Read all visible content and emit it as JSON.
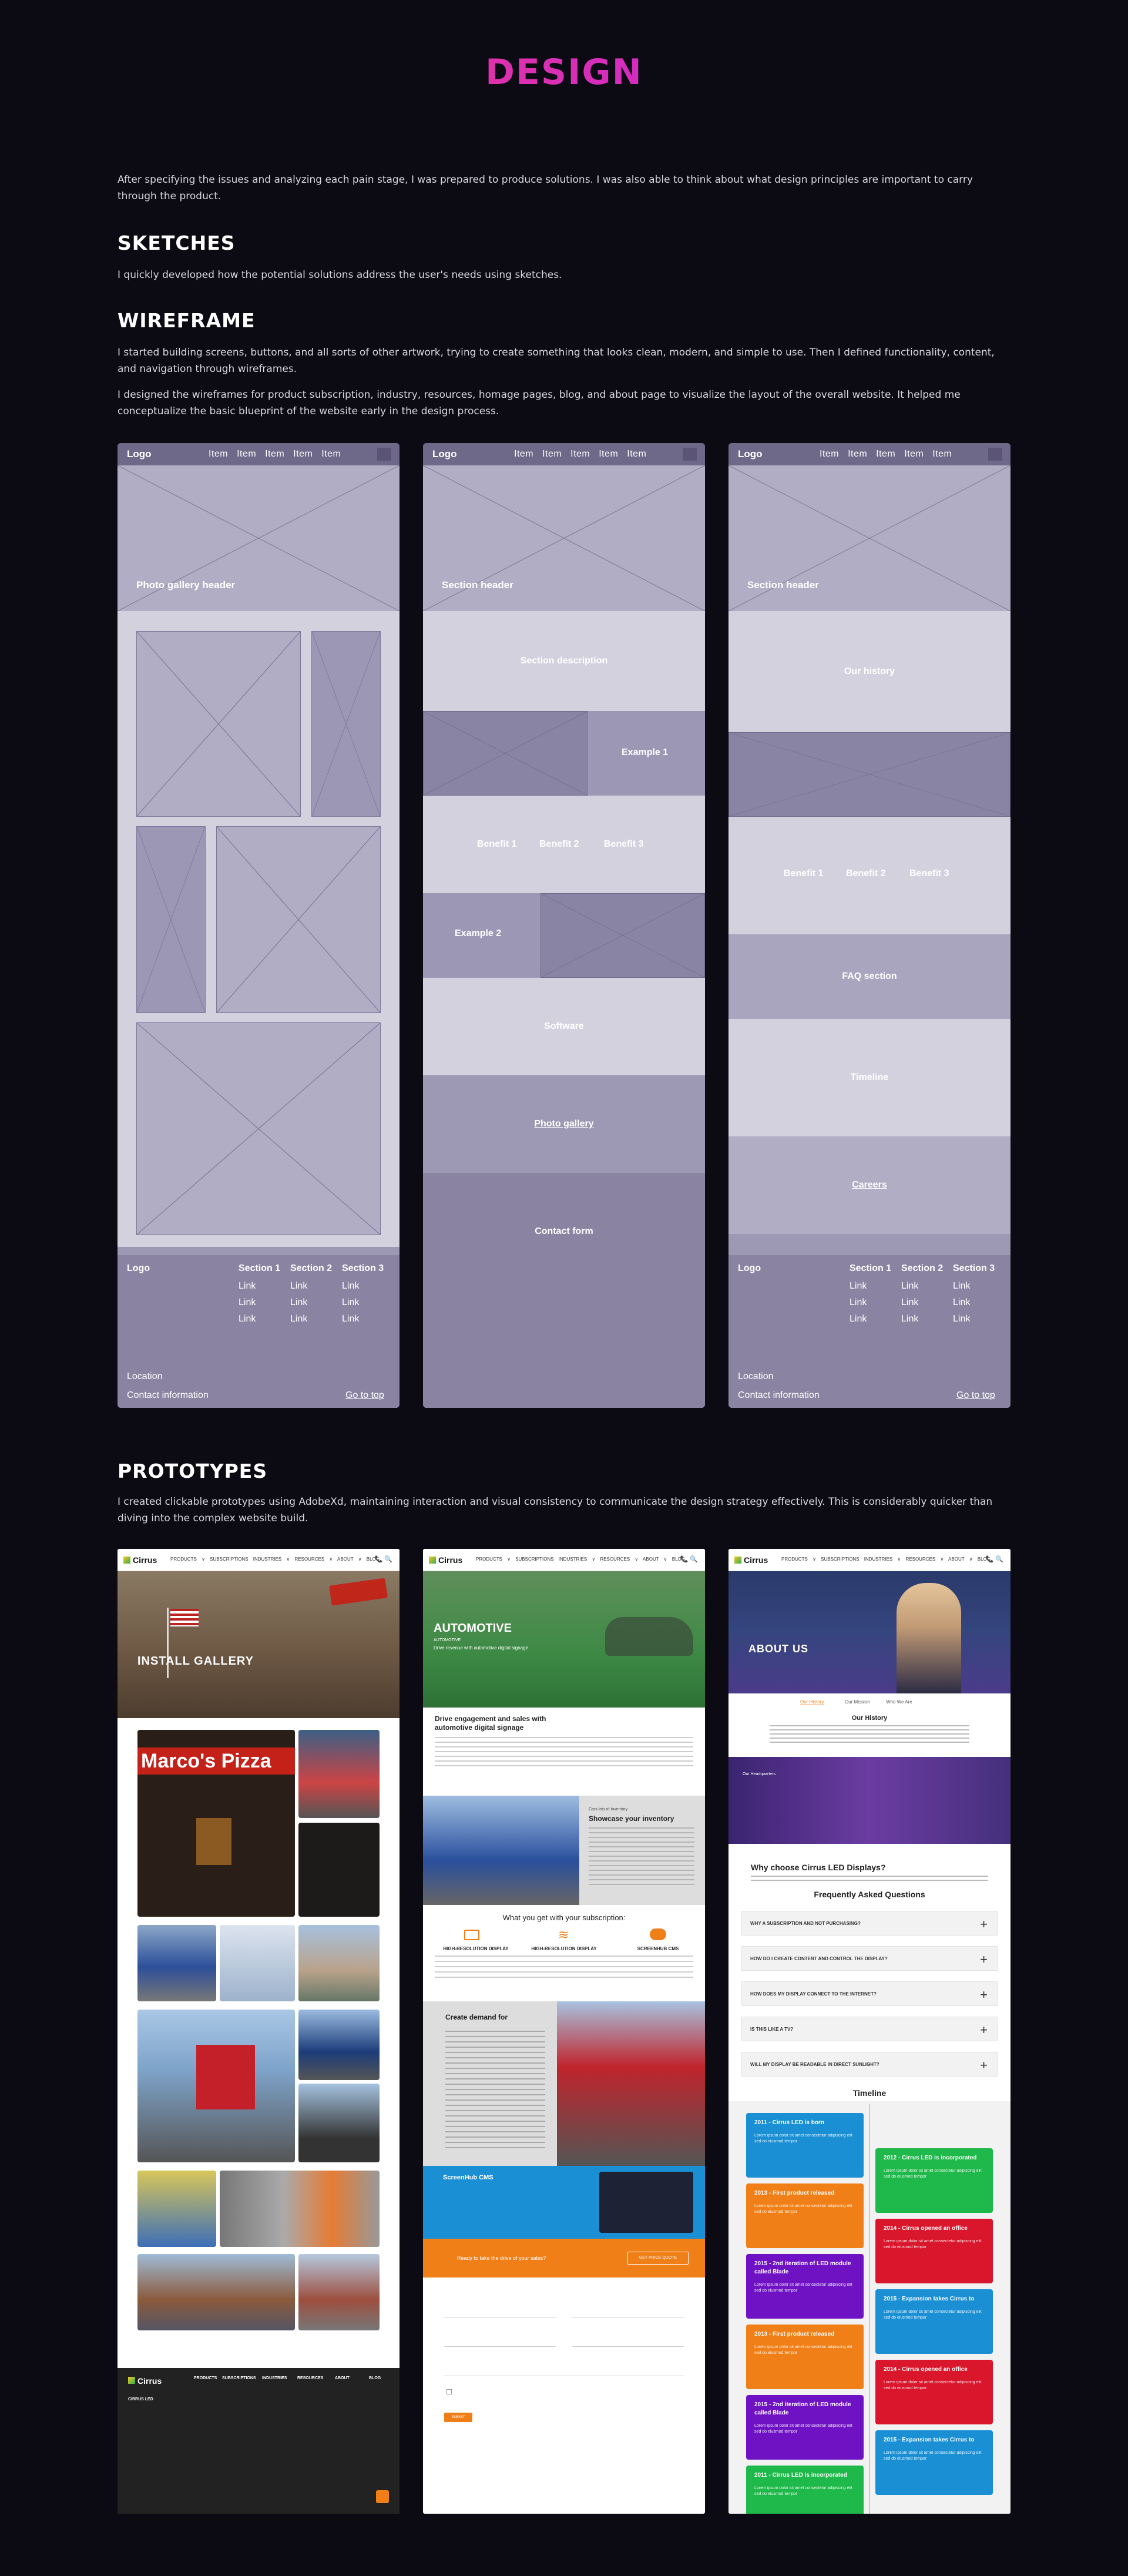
{
  "page": {
    "title": "DESIGN",
    "intro": "After specifying the issues and analyzing each pain stage, I was prepared to produce solutions. I was also able to think about what design principles are important to carry through the product.",
    "sketches_title": "SKETCHES",
    "sketches_text": "I quickly developed how the potential solutions address the user's needs using sketches.",
    "wireframe_title": "WIREFRAME",
    "wireframe_text1": "I started building screens, buttons, and all sorts of other artwork, trying to create something that looks clean, modern, and simple to use. Then I defined functionality, content, and navigation through wireframes.",
    "wireframe_text2": "I designed the wireframes for product subscription, industry, resources, homage pages, blog, and about page to visualize the layout of the overall website. It helped me conceptualize the basic blueprint of the website early in the design process.",
    "prototypes_title": "PROTOTYPES",
    "prototypes_text": "I created clickable prototypes using AdobeXd, maintaining interaction and visual consistency to communicate the design strategy effectively. This is considerably quicker than diving into the complex website build."
  },
  "wireframes": {
    "logo": "Logo",
    "nav_items": "Item Item Item Item Item",
    "wf1": {
      "header": "Photo gallery header"
    },
    "wf2": {
      "header": "Section header",
      "description": "Section description",
      "example1": "Example 1",
      "benefits": [
        "Benefit 1",
        "Benefit 2",
        "Benefit 3"
      ],
      "example2": "Example 2",
      "software": "Software",
      "gallery": "Photo gallery",
      "contact": "Contact form"
    },
    "wf3": {
      "header": "Section header",
      "history": "Our history",
      "benefits": [
        "Benefit 1",
        "Benefit 2",
        "Benefit 3"
      ],
      "faq": "FAQ section",
      "timeline": "Timeline",
      "careers": "Careers"
    },
    "footer": {
      "logo": "Logo",
      "sections": [
        "Section 1",
        "Section 2",
        "Section 3"
      ],
      "link": "Link",
      "location": "Location",
      "contact": "Contact information",
      "top": "Go to top"
    }
  },
  "prototypes": {
    "brand": "Cirrus",
    "menu": "PRODUCTS ∨  SUBSCRIPTIONS  INDUSTRIES ∨  RESOURCES ∨  ABOUT ∨  BLOG",
    "icons": "📞 🔍",
    "p1": {
      "hero": "INSTALL GALLERY",
      "sign_text": "Marco's Pizza",
      "footer_brand": "Cirrus",
      "footer_cols": [
        "PRODUCTS",
        "SUBSCRIPTIONS",
        "INDUSTRIES",
        "RESOURCES",
        "ABOUT",
        "BLOG"
      ],
      "footer_info": "CIRRUS LED"
    },
    "p2": {
      "hero": "AUTOMOTIVE",
      "hero_sub": "AUTOMOTIVE",
      "hero_line": "Drive revenue with automotive digital signage",
      "intro_title": "Drive engagement and sales with automotive digital signage",
      "showcase_kicker": "Cars lots of Inventory",
      "showcase_title": "Showcase your inventory",
      "subscription_title": "What you get with your subscription:",
      "features": [
        "HIGH-RESOLUTION DISPLAY",
        "HIGH-RESOLUTION DISPLAY",
        "SCREENHUB CMS"
      ],
      "demand_title": "Create demand for",
      "cms_title": "ScreenHub CMS",
      "cta_text": "Ready to take the drive of your sales?",
      "cta_button": "GET PRICE QUOTE",
      "submit": "SUBMIT"
    },
    "p3": {
      "hero": "ABOUT US",
      "tabs": [
        "Our History",
        "Our Mission",
        "Who We Are"
      ],
      "history_title": "Our History",
      "hq": "Our Headquarters",
      "why_title": "Why choose Cirrus LED Displays?",
      "faq_title": "Frequently Asked Questions",
      "faqs": [
        "WHY A SUBSCRIPTION AND NOT PURCHASING?",
        "HOW DO I CREATE CONTENT AND CONTROL THE DISPLAY?",
        "HOW DOES MY DISPLAY CONNECT TO THE INTERNET?",
        "IS THIS LIKE A TV?",
        "WILL MY DISPLAY BE READABLE IN DIRECT SUNLIGHT?"
      ],
      "timeline_title": "Timeline",
      "timeline_left": [
        {
          "label": "2011 - Cirrus LED is born",
          "color": "#1a8fd4"
        },
        {
          "label": "2013 - First product released",
          "color": "#f07f17"
        },
        {
          "label": "2015 - 2nd iteration of LED module called Blade",
          "color": "#6f12c4"
        },
        {
          "label": "2013 - First product released",
          "color": "#f07f17"
        },
        {
          "label": "2015 - 2nd iteration of LED module called Blade",
          "color": "#6f12c4"
        },
        {
          "label": "2011 - Cirrus LED is incorporated",
          "color": "#1fb84a"
        }
      ],
      "timeline_right": [
        {
          "label": "2012 - Cirrus LED is incorporated",
          "color": "#1fb84a"
        },
        {
          "label": "2014 - Cirrus opened an office",
          "color": "#d9162b"
        },
        {
          "label": "2015 - Expansion takes Cirrus to",
          "color": "#1a8fd4"
        },
        {
          "label": "2014 - Cirrus opened an office",
          "color": "#d9162b"
        },
        {
          "label": "2015 - Expansion takes Cirrus to",
          "color": "#1a8fd4"
        }
      ],
      "timeline_desc": "Lorem ipsum dolor sit amet consectetur adipiscing elit sed do eiusmod tempor"
    }
  }
}
